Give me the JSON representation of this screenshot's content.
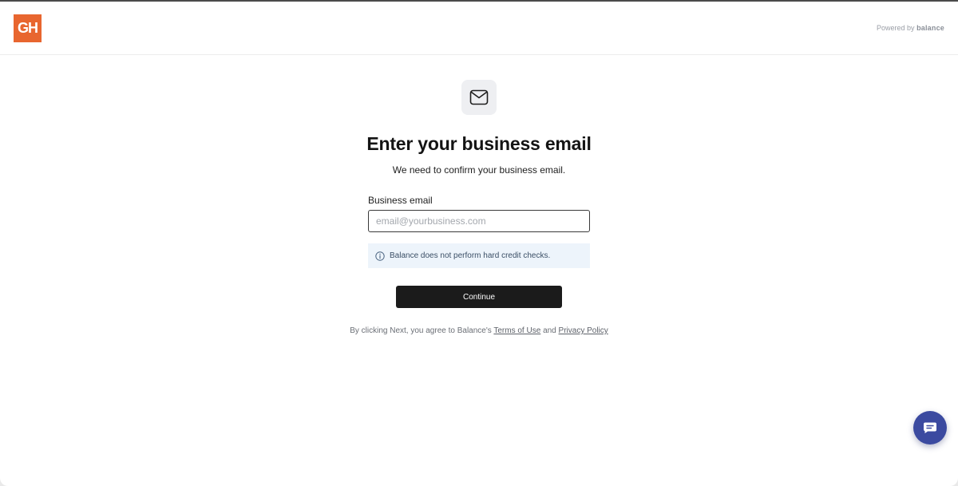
{
  "header": {
    "logo_text": "GH",
    "powered_prefix": "Powered by",
    "powered_brand": "balance"
  },
  "main": {
    "title": "Enter your business email",
    "subtitle": "We need to confirm your business email.",
    "email_label": "Business email",
    "email_value": "",
    "email_placeholder": "email@yourbusiness.com",
    "notice_text": "Balance does not perform hard credit checks.",
    "continue_label": "Continue"
  },
  "legal": {
    "prefix": "By clicking Next, you agree to Balance's",
    "terms_label": "Terms of Use",
    "and_text": "and",
    "privacy_label": "Privacy Policy"
  },
  "icons": {
    "mail": "mail-icon",
    "info": "info-icon",
    "chat": "chat-icon"
  },
  "colors": {
    "logo_bg": "#e8662f",
    "button_bg": "#1b1b1b",
    "notice_bg": "#edf4fb",
    "chat_bg": "#3b4aa0"
  }
}
